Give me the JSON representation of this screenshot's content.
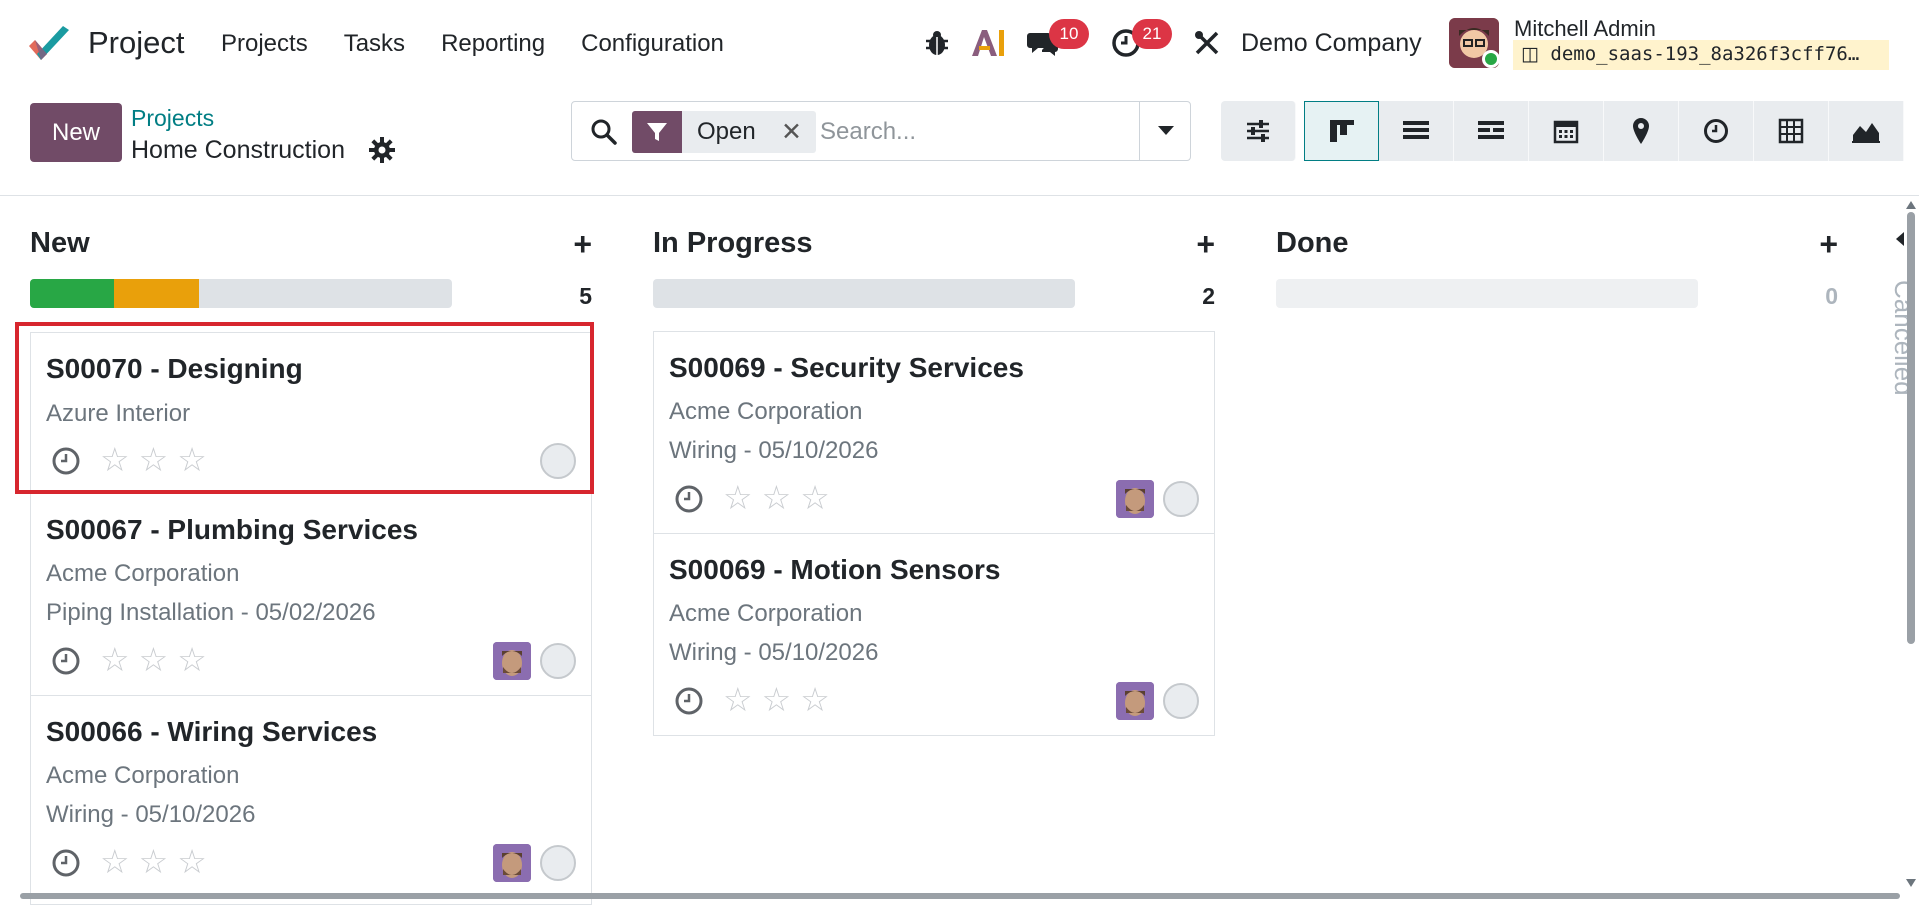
{
  "navbar": {
    "app_name": "Project",
    "menu": [
      "Projects",
      "Tasks",
      "Reporting",
      "Configuration"
    ],
    "messages_count": "10",
    "activities_count": "21",
    "company": "Demo Company",
    "user_name": "Mitchell Admin",
    "database": "demo_saas-193_8a326f3cff76…"
  },
  "control_panel": {
    "new_label": "New",
    "breadcrumb_parent": "Projects",
    "breadcrumb_current": "Home Construction",
    "facet_label": "Open",
    "search_placeholder": "Search...",
    "views": [
      "filter-settings",
      "kanban",
      "list",
      "gantt",
      "calendar",
      "map",
      "activity",
      "pivot",
      "graph"
    ],
    "active_view": "kanban"
  },
  "columns": [
    {
      "title": "New",
      "count": "5",
      "progress": {
        "green": 0.2,
        "orange": 0.2
      },
      "cards": [
        {
          "title": "S00070 - Designing",
          "customer": "Azure Interior",
          "detail": "",
          "has_avatar": false
        },
        {
          "title": "S00067 - Plumbing Services",
          "customer": "Acme Corporation",
          "detail": "Piping Installation - 05/02/2026",
          "has_avatar": true
        },
        {
          "title": "S00066 - Wiring Services",
          "customer": "Acme Corporation",
          "detail": "Wiring - 05/10/2026",
          "has_avatar": true
        }
      ]
    },
    {
      "title": "In Progress",
      "count": "2",
      "progress": {
        "green": 0,
        "orange": 0
      },
      "cards": [
        {
          "title": "S00069 - Security Services",
          "customer": "Acme Corporation",
          "detail": "Wiring - 05/10/2026",
          "has_avatar": true
        },
        {
          "title": "S00069 - Motion Sensors",
          "customer": "Acme Corporation",
          "detail": "Wiring - 05/10/2026",
          "has_avatar": true
        }
      ]
    },
    {
      "title": "Done",
      "count": "0",
      "progress": {
        "green": 0,
        "orange": 0
      },
      "cards": []
    }
  ],
  "folded_column": "Cancelled",
  "colors": {
    "brand": "#714b67",
    "link": "#017e84",
    "badge": "#dc3545",
    "progress_green": "#28a745",
    "progress_orange": "#e9a00b",
    "highlight": "#d7262e"
  }
}
